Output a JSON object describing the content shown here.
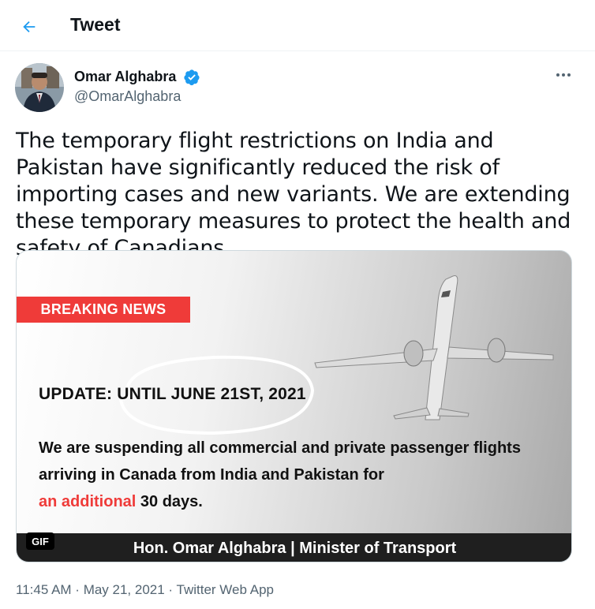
{
  "header": {
    "title": "Tweet",
    "back_icon": "arrow-left-icon",
    "accent_color": "#1d9bf0"
  },
  "author": {
    "name": "Omar Alghabra",
    "handle": "@OmarAlghabra",
    "verified_icon": "verified-badge-icon",
    "more_icon": "more-horizontal-icon"
  },
  "tweet": {
    "text": "The temporary flight restrictions on India and Pakistan have significantly reduced the risk of importing cases and new variants. We are extending these temporary measures to protect the health and safety of Canadians."
  },
  "media": {
    "badge": "BREAKING NEWS",
    "update": "UPDATE: UNTIL JUNE 21ST, 2021",
    "body_line1": "We are suspending all commercial and private passenger flights",
    "body_line2": "arriving in Canada from India and Pakistan for",
    "body_highlight": "an additional",
    "body_end": " 30 days.",
    "footer": "Hon. Omar Alghabra | Minister of Transport",
    "gif_label": "GIF",
    "highlight_color": "#ef3b39"
  },
  "meta": {
    "time": "11:45 AM",
    "separator": " · ",
    "date": "May 21, 2021",
    "app": "Twitter Web App"
  }
}
